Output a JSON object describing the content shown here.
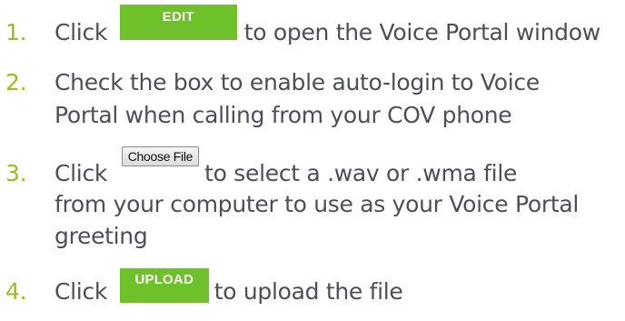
{
  "steps": [
    {
      "number": "1.",
      "before": "Click",
      "button": "EDIT",
      "after": "to open the Voice Portal window"
    },
    {
      "number": "2.",
      "line1": "Check the box to enable auto-login to Voice",
      "line2": "Portal when calling from your COV phone"
    },
    {
      "number": "3.",
      "before": "Click",
      "button": "Choose File",
      "after": "to select a .wav or .wma file",
      "line2": "from your computer to use as your Voice Portal",
      "line3": "greeting"
    },
    {
      "number": "4.",
      "before": "Click",
      "button": "UPLOAD",
      "after": "to upload the file"
    }
  ],
  "colors": {
    "number": "#a3b81f",
    "text": "#4a4f59",
    "button_green": "#6ec12a"
  }
}
